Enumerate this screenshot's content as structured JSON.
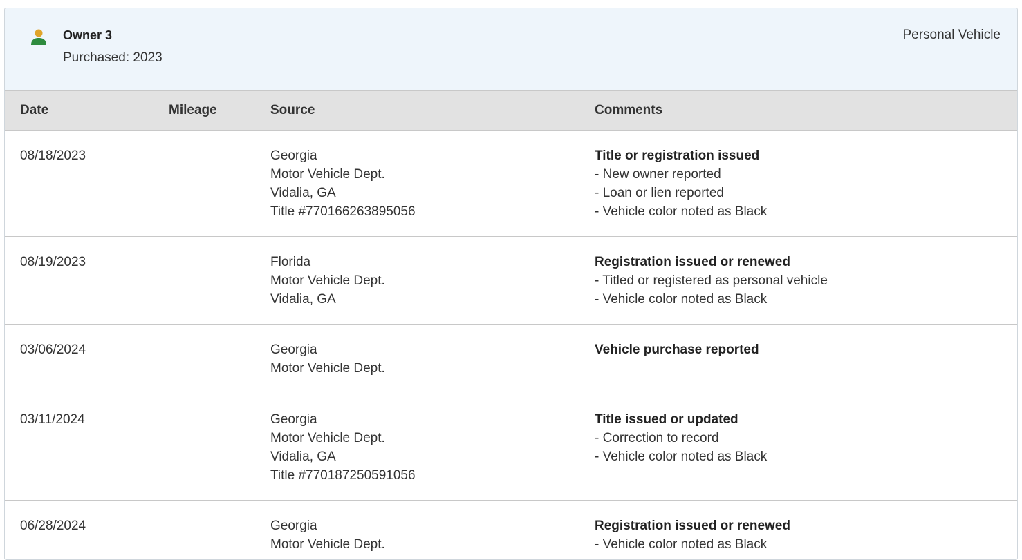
{
  "owner": {
    "title": "Owner 3",
    "purchased": "Purchased: 2023",
    "type": "Personal Vehicle",
    "icon": "person-icon",
    "icon_colors": {
      "head": "#e0a42a",
      "body": "#2e8b3e"
    }
  },
  "table": {
    "headers": [
      "Date",
      "Mileage",
      "Source",
      "Comments"
    ],
    "rows": [
      {
        "date": "08/18/2023",
        "mileage": "",
        "source": [
          "Georgia",
          "Motor Vehicle Dept.",
          "Vidalia, GA",
          "Title #770166263895056"
        ],
        "comment_title": "Title or registration issued",
        "comment_items": [
          "- New owner reported",
          "- Loan or lien reported",
          "- Vehicle color noted as Black"
        ]
      },
      {
        "date": "08/19/2023",
        "mileage": "",
        "source": [
          "Florida",
          "Motor Vehicle Dept.",
          "Vidalia, GA"
        ],
        "comment_title": "Registration issued or renewed",
        "comment_items": [
          "- Titled or registered as personal vehicle",
          "- Vehicle color noted as Black"
        ]
      },
      {
        "date": "03/06/2024",
        "mileage": "",
        "source": [
          "Georgia",
          "Motor Vehicle Dept."
        ],
        "comment_title": "Vehicle purchase reported",
        "comment_items": []
      },
      {
        "date": "03/11/2024",
        "mileage": "",
        "source": [
          "Georgia",
          "Motor Vehicle Dept.",
          "Vidalia, GA",
          "Title #770187250591056"
        ],
        "comment_title": "Title issued or updated",
        "comment_items": [
          "- Correction to record",
          "- Vehicle color noted as Black"
        ]
      },
      {
        "date": "06/28/2024",
        "mileage": "",
        "source": [
          "Georgia",
          "Motor Vehicle Dept."
        ],
        "comment_title": "Registration issued or renewed",
        "comment_items": [
          "- Vehicle color noted as Black"
        ]
      }
    ]
  }
}
